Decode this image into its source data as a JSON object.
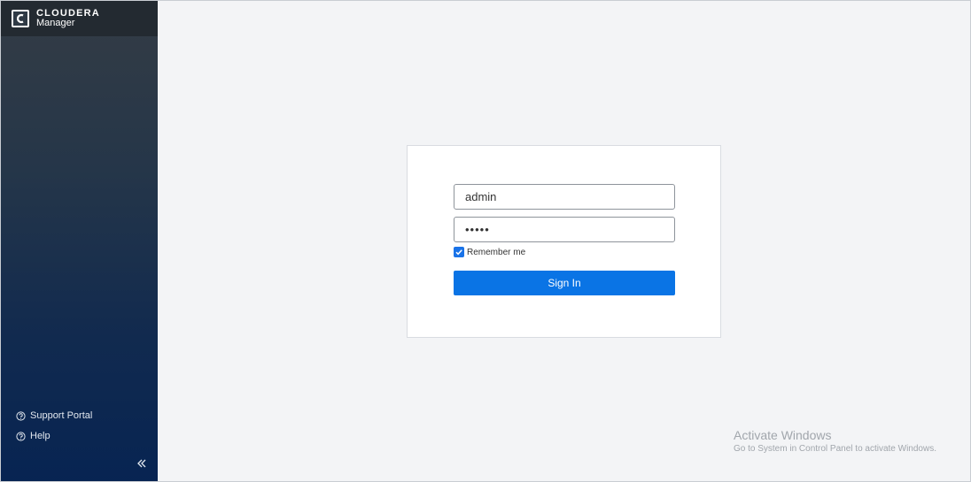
{
  "brand": {
    "name": "CLOUDERA",
    "product": "Manager"
  },
  "sidebar": {
    "links": [
      {
        "label": "Support Portal",
        "icon": "help-circle-icon"
      },
      {
        "label": "Help",
        "icon": "help-circle-icon"
      }
    ],
    "collapse_icon": "double-chevron-left-icon"
  },
  "login": {
    "username_value": "admin",
    "password_value": "•••••",
    "remember_label": "Remember me",
    "remember_checked": true,
    "signin_label": "Sign In"
  },
  "watermark": {
    "title": "Activate Windows",
    "subtitle": "Go to System in Control Panel to activate Windows."
  },
  "colors": {
    "accent": "#0a74e5",
    "sidebar_top": "#343c45",
    "sidebar_bottom": "#072452",
    "background": "#f3f4f6"
  }
}
